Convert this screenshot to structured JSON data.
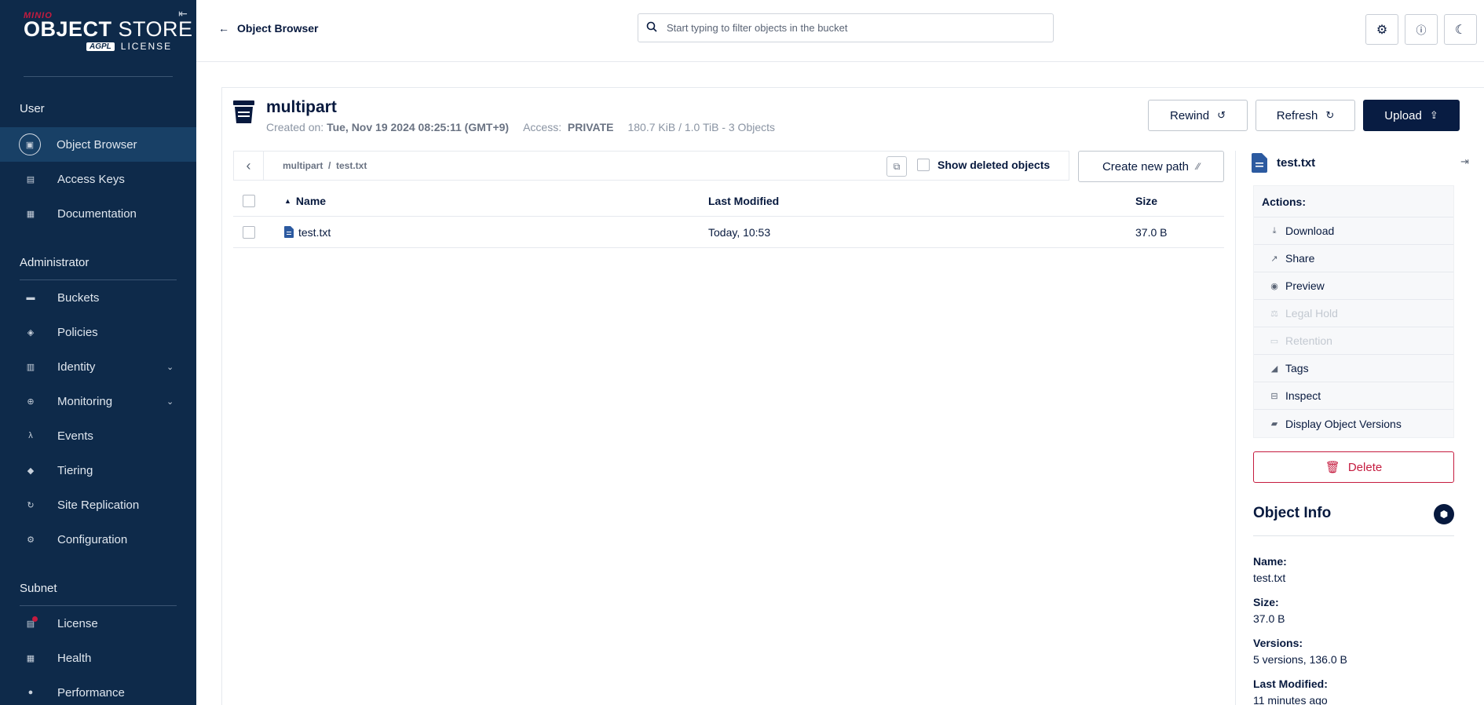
{
  "brand": {
    "minio": "MINIO",
    "name_bold": "OBJECT",
    "name_thin": "STORE",
    "agpl": "AGPL",
    "license": "LICENSE"
  },
  "sidebar": {
    "sections": [
      {
        "title": "User",
        "items": [
          {
            "label": "Object Browser",
            "icon": "object-browser-icon"
          },
          {
            "label": "Access Keys",
            "icon": "access-keys-icon"
          },
          {
            "label": "Documentation",
            "icon": "documentation-icon"
          }
        ]
      },
      {
        "title": "Administrator",
        "items": [
          {
            "label": "Buckets",
            "icon": "buckets-icon"
          },
          {
            "label": "Policies",
            "icon": "policies-icon"
          },
          {
            "label": "Identity",
            "icon": "identity-icon"
          },
          {
            "label": "Monitoring",
            "icon": "monitoring-icon"
          },
          {
            "label": "Events",
            "icon": "events-icon"
          },
          {
            "label": "Tiering",
            "icon": "tiering-icon"
          },
          {
            "label": "Site Replication",
            "icon": "site-replication-icon"
          },
          {
            "label": "Configuration",
            "icon": "configuration-icon"
          }
        ]
      },
      {
        "title": "Subnet",
        "items": [
          {
            "label": "License",
            "icon": "license-icon"
          },
          {
            "label": "Health",
            "icon": "health-icon"
          },
          {
            "label": "Performance",
            "icon": "performance-icon"
          }
        ]
      }
    ]
  },
  "header": {
    "back_label": "Object Browser",
    "search_placeholder": "Start typing to filter objects in the bucket"
  },
  "bucket": {
    "name": "multipart",
    "created_label": "Created on:",
    "created_value": "Tue, Nov 19 2024 08:25:11 (GMT+9)",
    "access_label": "Access:",
    "access_value": "PRIVATE",
    "usage": "180.7 KiB / 1.0 TiB - 3 Objects",
    "rewind_label": "Rewind",
    "refresh_label": "Refresh",
    "upload_label": "Upload"
  },
  "browser": {
    "breadcrumb": "multipart  /  test.txt",
    "show_deleted_label": "Show deleted objects",
    "create_path_label": "Create new path",
    "columns": {
      "name": "Name",
      "modified": "Last Modified",
      "size": "Size"
    },
    "rows": [
      {
        "name": "test.txt",
        "modified": "Today, 10:53",
        "size": "37.0 B"
      }
    ]
  },
  "panel": {
    "title": "test.txt",
    "actions_label": "Actions:",
    "actions": [
      {
        "label": "Download",
        "icon": "download-icon",
        "enabled": true
      },
      {
        "label": "Share",
        "icon": "share-icon",
        "enabled": true
      },
      {
        "label": "Preview",
        "icon": "preview-icon",
        "enabled": true
      },
      {
        "label": "Legal Hold",
        "icon": "legal-hold-icon",
        "enabled": false
      },
      {
        "label": "Retention",
        "icon": "retention-icon",
        "enabled": false
      },
      {
        "label": "Tags",
        "icon": "tags-icon",
        "enabled": true
      },
      {
        "label": "Inspect",
        "icon": "inspect-icon",
        "enabled": true
      },
      {
        "label": "Display Object Versions",
        "icon": "versions-icon",
        "enabled": true
      }
    ],
    "delete_label": "Delete",
    "info_title": "Object Info",
    "info": {
      "name_label": "Name:",
      "name_value": "test.txt",
      "size_label": "Size:",
      "size_value": "37.0 B",
      "versions_label": "Versions:",
      "versions_value": "5 versions, 136.0 B",
      "modified_label": "Last Modified:",
      "modified_value": "11 minutes ago"
    }
  },
  "colors": {
    "sidebar_bg": "#0e2a4a",
    "active_item": "#184066",
    "primary": "#081c42",
    "danger": "#c51b3f"
  }
}
